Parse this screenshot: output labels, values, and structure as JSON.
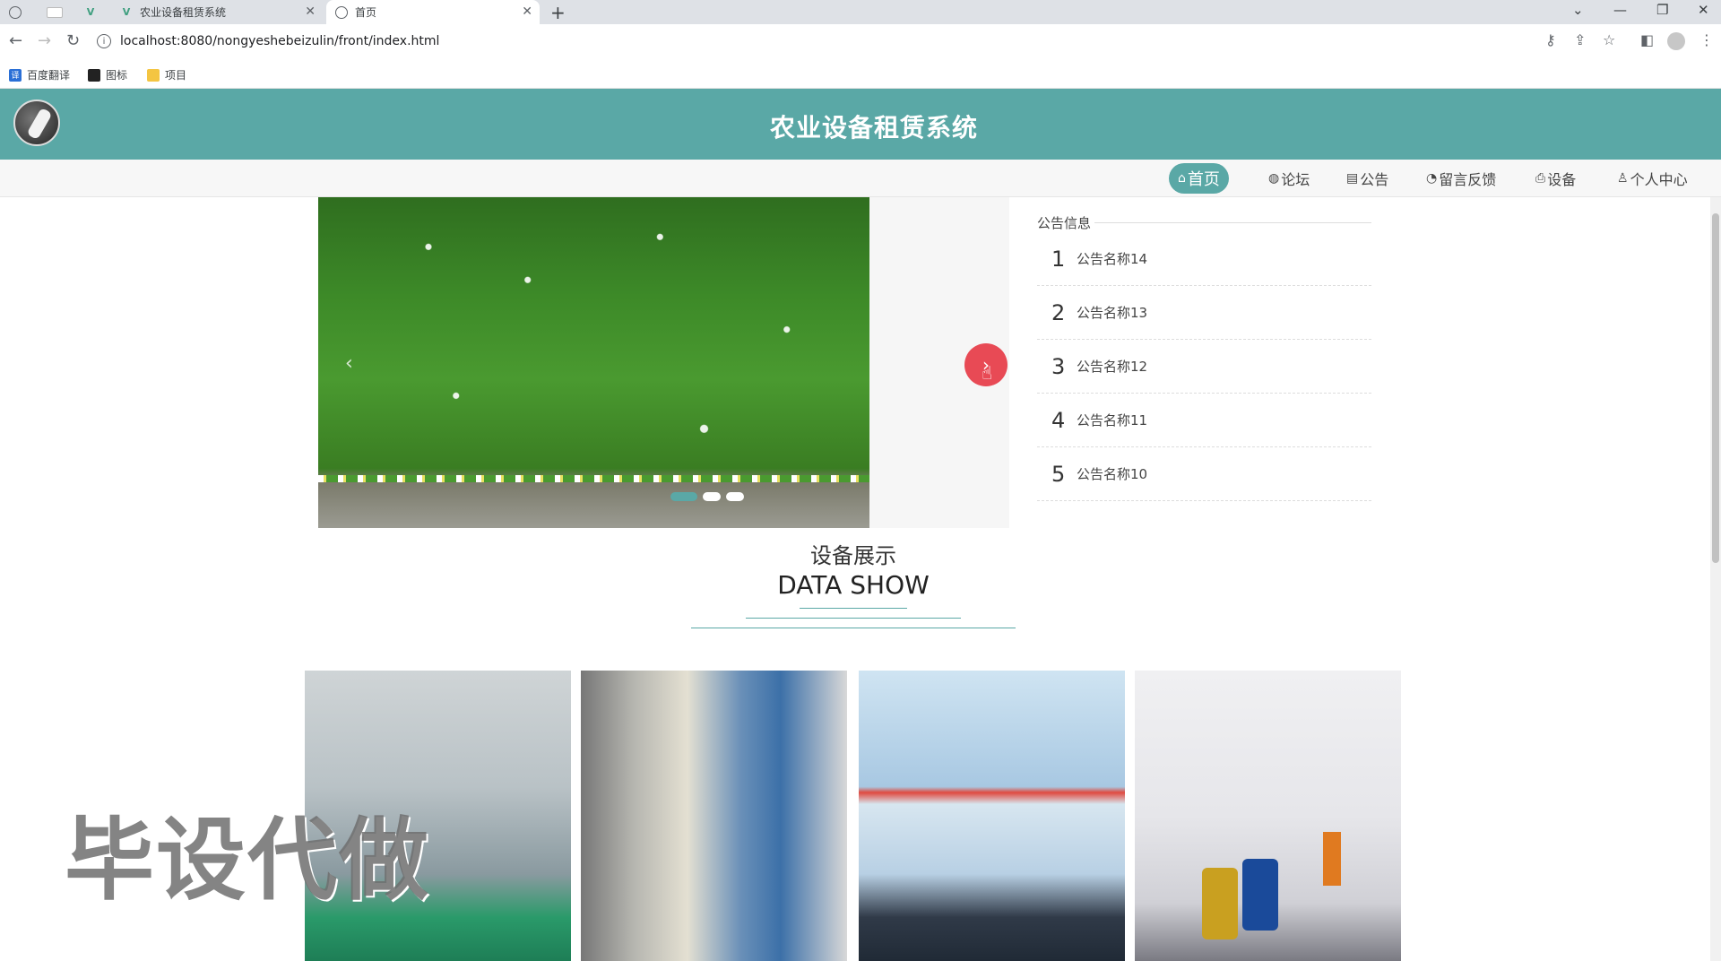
{
  "browser": {
    "tabs": [
      {
        "label": "",
        "active": false
      },
      {
        "label": "",
        "active": false
      },
      {
        "label": "",
        "active": false
      },
      {
        "label": "农业设备租赁系统",
        "active": false
      },
      {
        "label": "首页",
        "active": true
      }
    ],
    "url": "localhost:8080/nongyeshebeizulin/front/index.html",
    "bookmarks": [
      "百度翻译",
      "图标",
      "项目"
    ]
  },
  "site": {
    "title": "农业设备租赁系统",
    "nav": [
      {
        "label": "首页",
        "icon": "home-icon",
        "active": true
      },
      {
        "label": "论坛",
        "icon": "forum-icon",
        "active": false
      },
      {
        "label": "公告",
        "icon": "notice-icon",
        "active": false
      },
      {
        "label": "留言反馈",
        "icon": "feedback-icon",
        "active": false
      },
      {
        "label": "设备",
        "icon": "device-icon",
        "active": false
      },
      {
        "label": "个人中心",
        "icon": "user-icon",
        "active": false
      }
    ]
  },
  "notice": {
    "title": "公告信息",
    "items": [
      {
        "num": "1",
        "name": "公告名称14"
      },
      {
        "num": "2",
        "name": "公告名称13"
      },
      {
        "num": "3",
        "name": "公告名称12"
      },
      {
        "num": "4",
        "name": "公告名称11"
      },
      {
        "num": "5",
        "name": "公告名称10"
      }
    ]
  },
  "section": {
    "title_cn": "设备展示",
    "title_en": "DATA SHOW"
  },
  "watermark": "毕设代做",
  "colors": {
    "primary": "#5aa8a6",
    "carousel_next": "#e84a55"
  }
}
